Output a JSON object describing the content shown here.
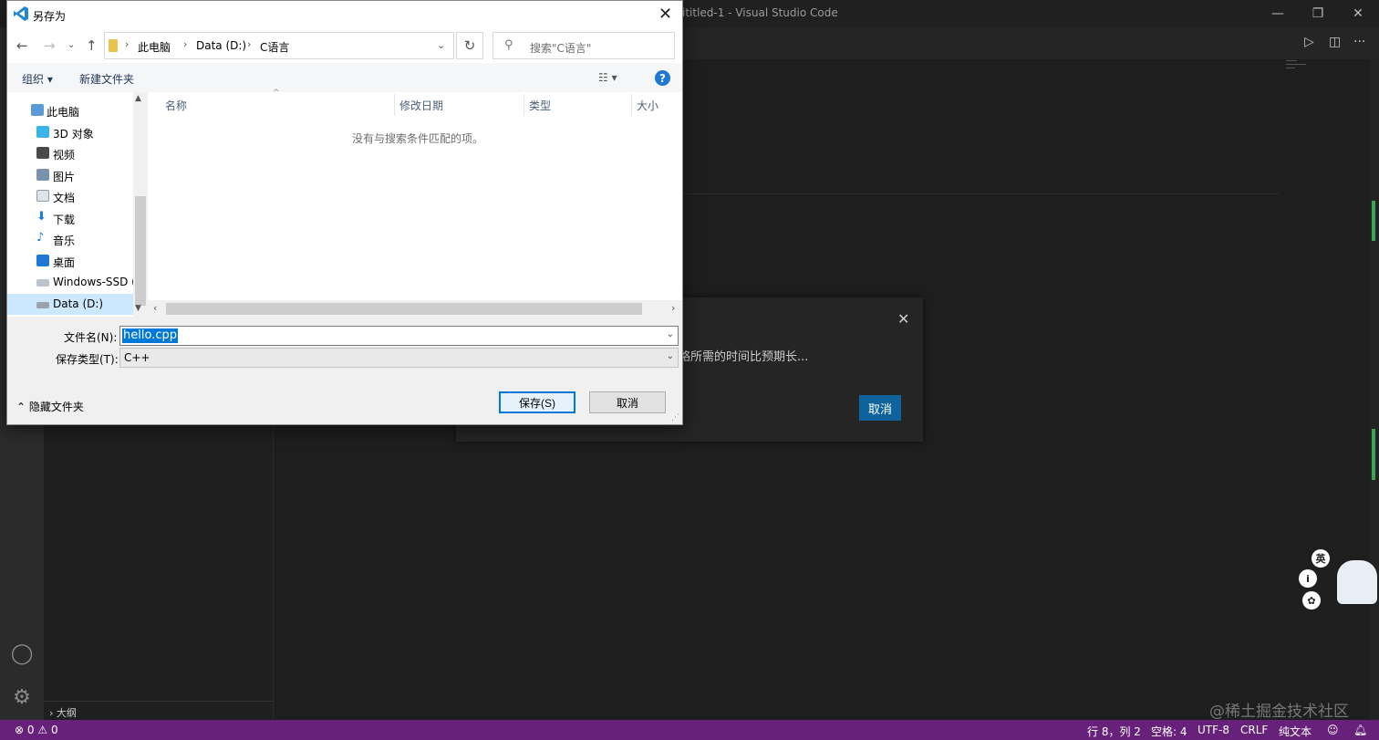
{
  "vscode": {
    "window_title": "Untitled-1 - Visual Studio Code",
    "window_title_visible": "ititled-1 - Visual Studio Code",
    "outline_label": "大纲",
    "status": {
      "errors": "0",
      "warnings": "0",
      "position": "行 8，列 2",
      "spaces": "空格: 4",
      "encoding": "UTF-8",
      "eol": "CRLF",
      "language": "纯文本"
    },
    "notification": {
      "message": "略所需的时间比预期长...",
      "cancel_label": "取消"
    },
    "ime_label": "英",
    "watermark": "@稀土掘金技术社区"
  },
  "dialog": {
    "title": "另存为",
    "breadcrumb": [
      "此电脑",
      "Data (D:)",
      "C语言"
    ],
    "search_placeholder": "搜索\"C语言\"",
    "toolbar": {
      "organize": "组织 ▾",
      "new_folder": "新建文件夹"
    },
    "nav_items": [
      {
        "label": "此电脑",
        "icon": "computer-icon"
      },
      {
        "label": "3D 对象",
        "icon": "3d-objects-icon"
      },
      {
        "label": "视频",
        "icon": "video-icon"
      },
      {
        "label": "图片",
        "icon": "pictures-icon"
      },
      {
        "label": "文档",
        "icon": "documents-icon"
      },
      {
        "label": "下载",
        "icon": "download-icon"
      },
      {
        "label": "音乐",
        "icon": "music-icon"
      },
      {
        "label": "桌面",
        "icon": "desktop-icon"
      },
      {
        "label": "Windows-SSD (",
        "icon": "drive-icon"
      },
      {
        "label": "Data (D:)",
        "icon": "drive-icon"
      }
    ],
    "columns": [
      "名称",
      "修改日期",
      "类型",
      "大小"
    ],
    "empty_message": "没有与搜索条件匹配的项。",
    "filename_label": "文件名(N):",
    "filename_value": "hello.cpp",
    "filetype_label": "保存类型(T):",
    "filetype_value": "C++",
    "hide_folders": "隐藏文件夹",
    "save_label": "保存(S)",
    "cancel_label": "取消"
  }
}
